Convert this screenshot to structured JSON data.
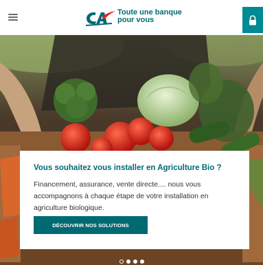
{
  "header": {
    "menu_icon": "hamburger-menu-icon",
    "logo": {
      "mark": "CA",
      "tagline_line1": "Toute une banque",
      "tagline_line2": "pour vous"
    },
    "lock_icon": "lock-icon"
  },
  "hero": {
    "title": "Vous souhaitez vous installer en Agriculture Bio ?",
    "text": "Financement, assurance, vente directe.... nous vous accompagnons à chaque étape de votre installation en agriculture biologique.",
    "cta_label": "DÉCOUVRIR NOS SOLUTIONS",
    "carousel": {
      "slides": 4,
      "active_index": 1
    }
  },
  "colors": {
    "brand_teal": "#006a73",
    "accent_teal": "#008a93",
    "menu_gray": "#5f6b6c"
  }
}
